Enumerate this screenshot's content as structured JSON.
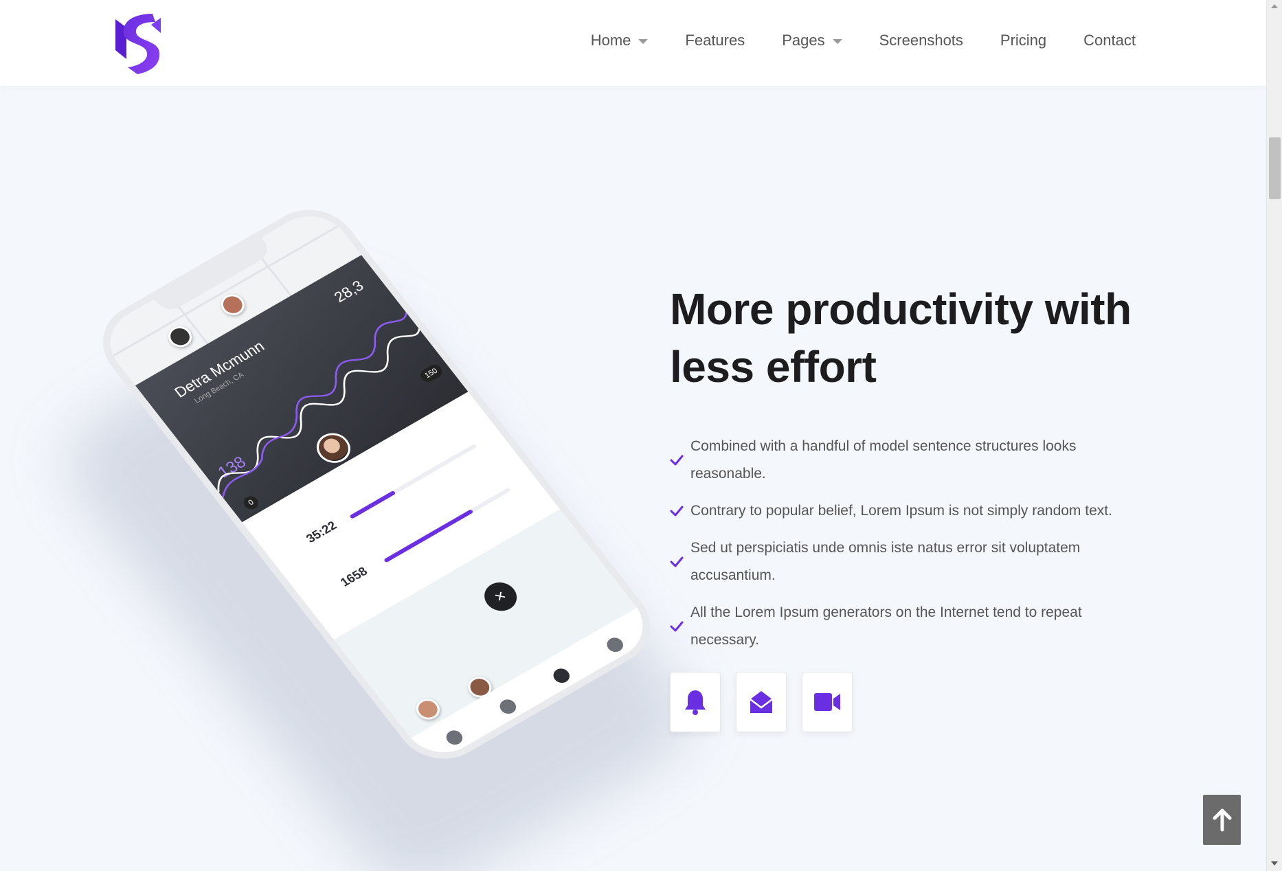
{
  "nav": {
    "items": [
      {
        "label": "Home",
        "has_dropdown": true
      },
      {
        "label": "Features",
        "has_dropdown": false
      },
      {
        "label": "Pages",
        "has_dropdown": true
      },
      {
        "label": "Screenshots",
        "has_dropdown": false
      },
      {
        "label": "Pricing",
        "has_dropdown": false
      },
      {
        "label": "Contact",
        "has_dropdown": false
      }
    ]
  },
  "brand": {
    "logo_icon": "s-logo-icon",
    "accent": "#6a2fe0"
  },
  "phone": {
    "name": "Detra Mcmunn",
    "location": "Long Beach, CA",
    "value_right": "28,3",
    "value_left": "138",
    "badge_top": "150",
    "badge_bottom": "0",
    "stat_time": "35:22",
    "stat_count": "1658",
    "bar1_fraction": 0.35,
    "bar2_fraction": 0.7
  },
  "content": {
    "headline_line1": "More productivity with",
    "headline_line2": "less effort",
    "features": [
      "Combined with a handful of model sentence structures looks reasonable.",
      "Contrary to popular belief, Lorem Ipsum is not simply random text.",
      "Sed ut perspiciatis unde omnis iste natus error sit voluptatem accusantium.",
      "All the Lorem Ipsum generators on the Internet tend to repeat necessary."
    ],
    "icons": [
      "bell-icon",
      "envelope-open-icon",
      "video-camera-icon"
    ]
  },
  "back_to_top": {
    "icon": "arrow-up-icon"
  }
}
